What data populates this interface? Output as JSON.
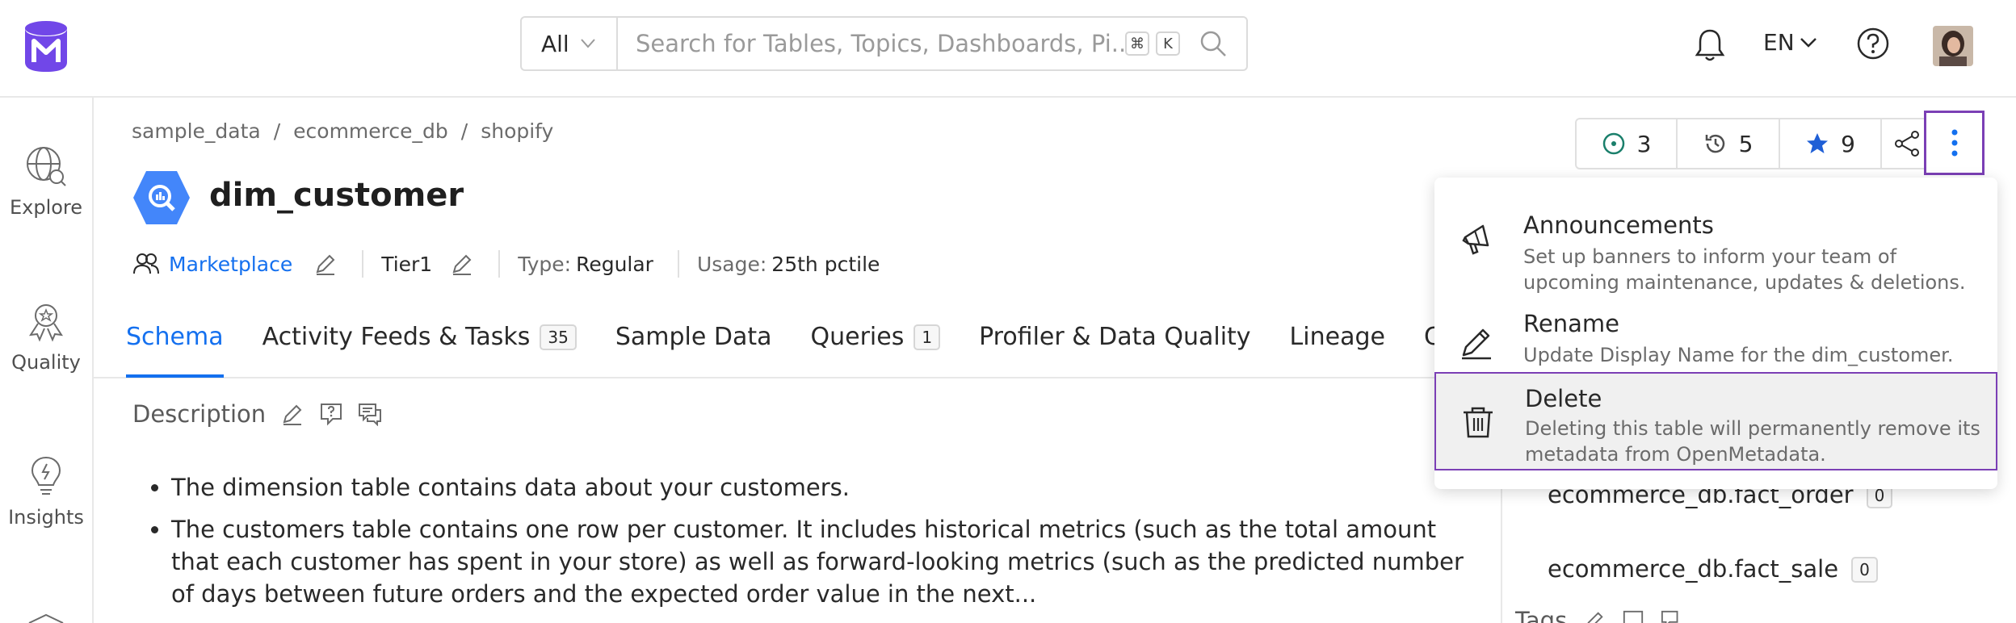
{
  "navbar": {
    "search_type": "All",
    "search_placeholder": "Search for Tables, Topics, Dashboards, Pi...",
    "shortcut_cmd": "⌘",
    "shortcut_key": "K",
    "language": "EN"
  },
  "sidebar": {
    "items": [
      {
        "label": "Explore",
        "icon": "explore-icon"
      },
      {
        "label": "Quality",
        "icon": "quality-icon"
      },
      {
        "label": "Insights",
        "icon": "insights-icon"
      }
    ]
  },
  "breadcrumb": [
    "sample_data",
    "ecommerce_db",
    "shopify"
  ],
  "breadcrumb_sep": "/",
  "entity": {
    "title": "dim_customer",
    "owner": "Marketplace",
    "tier": "Tier1",
    "type_label": "Type:",
    "type_value": "Regular",
    "usage_label": "Usage:",
    "usage_value": "25th pctile"
  },
  "actions": {
    "followers": "3",
    "versions": "5",
    "stars": "9"
  },
  "tabs": [
    {
      "label": "Schema",
      "active": true
    },
    {
      "label": "Activity Feeds & Tasks",
      "count": "35"
    },
    {
      "label": "Sample Data"
    },
    {
      "label": "Queries",
      "count": "1"
    },
    {
      "label": "Profiler & Data Quality"
    },
    {
      "label": "Lineage"
    },
    {
      "label": "Cust"
    }
  ],
  "description": {
    "heading": "Description",
    "bullets": [
      "The dimension table contains data about your customers.",
      "The customers table contains one row per customer. It includes historical metrics (such as the total amount that each customer has spent in your store) as well as forward-looking metrics (such as the predicted number of days between future orders and the expected order value in the next..."
    ]
  },
  "right": {
    "lineage_items": [
      {
        "name": "ecommerce_db.fact_order",
        "count": "0"
      },
      {
        "name": "ecommerce_db.fact_sale",
        "count": "0"
      }
    ],
    "tags_heading": "Tags"
  },
  "dropdown": {
    "items": [
      {
        "title": "Announcements",
        "desc": "Set up banners to inform your team of upcoming maintenance, updates & deletions.",
        "icon": "megaphone-icon"
      },
      {
        "title": "Rename",
        "desc": "Update Display Name for the dim_customer.",
        "icon": "pencil-icon"
      },
      {
        "title": "Delete",
        "desc": "Deleting this table will permanently remove its metadata from OpenMetadata.",
        "icon": "trash-icon",
        "selected": true
      }
    ]
  },
  "colors": {
    "brand": "#7147e8",
    "link": "#1470ef",
    "highlight": "#7b3fb5"
  }
}
